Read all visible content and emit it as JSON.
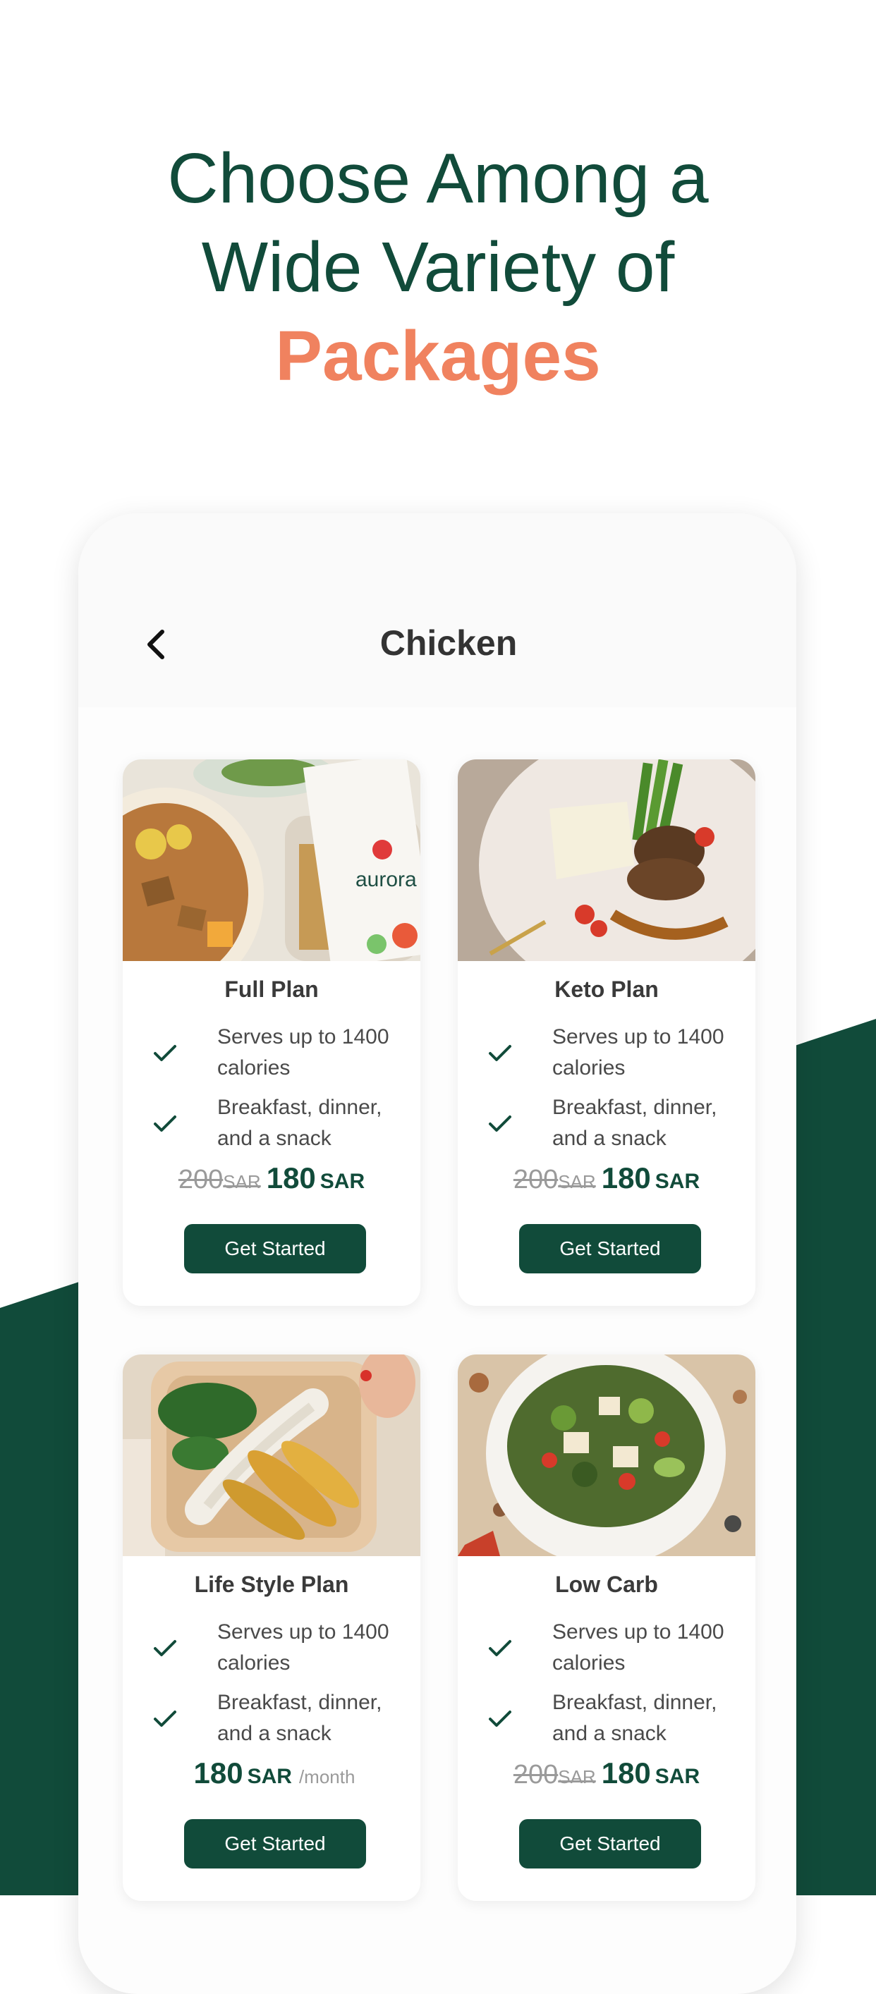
{
  "headline": {
    "line1": "Choose Among a",
    "line2": "Wide Variety of",
    "accent": "Packages"
  },
  "colors": {
    "brand_green": "#114b3a",
    "accent_orange": "#f0825f"
  },
  "screen": {
    "title": "Chicken",
    "back_icon": "chevron-left-icon"
  },
  "plans": [
    {
      "name": "Full Plan",
      "features": [
        "Serves up to 1400 calories",
        "Breakfast, dinner, and a snack"
      ],
      "old_price": "200",
      "old_currency": "SAR",
      "price": "180",
      "currency": "SAR",
      "button": "Get Started"
    },
    {
      "name": "Keto Plan",
      "features": [
        "Serves up to 1400 calories",
        "Breakfast, dinner, and a snack"
      ],
      "old_price": "200",
      "old_currency": "SAR",
      "price": "180",
      "currency": "SAR",
      "button": "Get Started"
    },
    {
      "name": "Life Style Plan",
      "features": [
        "Serves up to 1400 calories",
        "Breakfast, dinner, and a snack"
      ],
      "price": "180",
      "currency": "SAR",
      "period": "/month",
      "button": "Get Started"
    },
    {
      "name": "Low Carb",
      "features": [
        "Serves up to 1400 calories",
        "Breakfast, dinner, and a snack"
      ],
      "old_price": "200",
      "old_currency": "SAR",
      "price": "180",
      "currency": "SAR",
      "button": "Get Started"
    }
  ]
}
